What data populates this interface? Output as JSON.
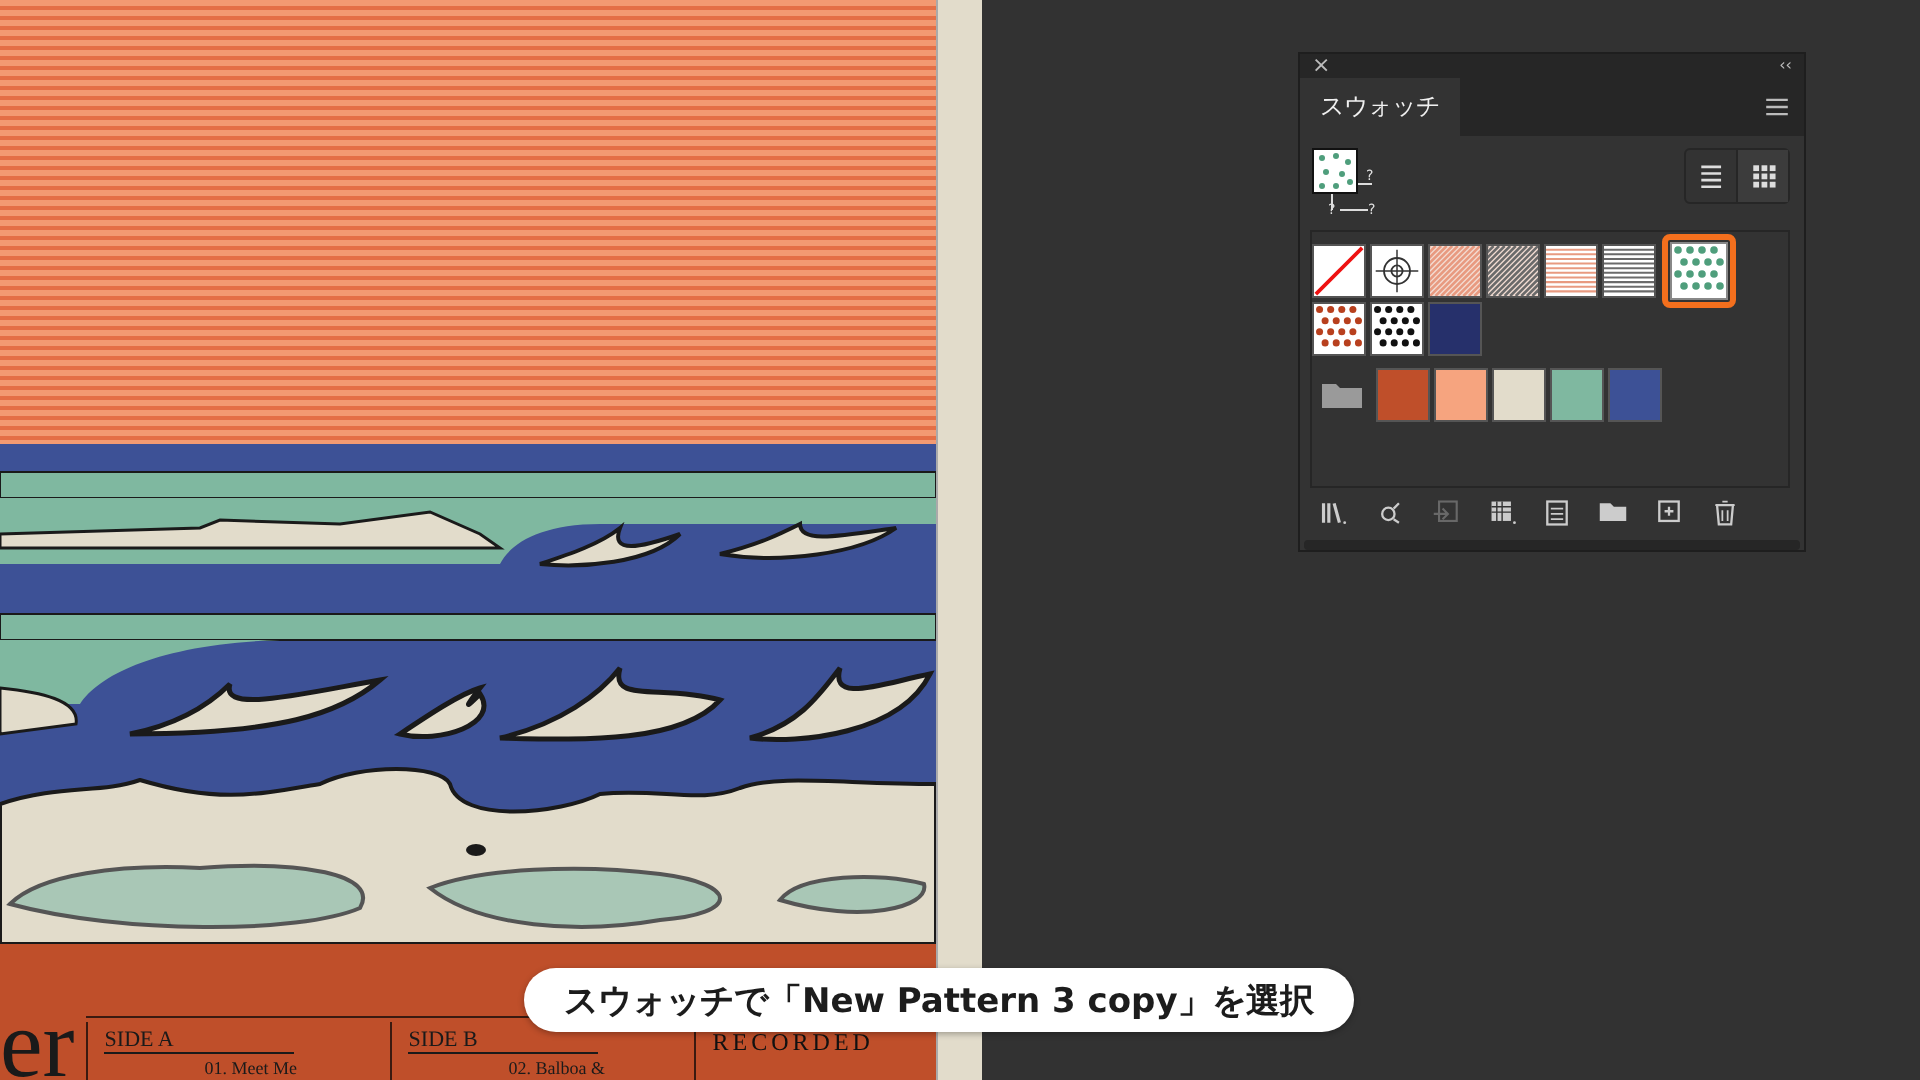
{
  "artwork": {
    "title_fragment": "er",
    "sections": [
      {
        "heading": "SIDE A",
        "track": "01. Meet Me"
      },
      {
        "heading": "SIDE B",
        "track": "02. Balboa &"
      },
      {
        "heading": "RECORDED"
      }
    ]
  },
  "panel": {
    "close": "×",
    "collapse": "‹‹",
    "fill_stroke_marks": [
      "?",
      "?",
      "?"
    ],
    "tabs": [
      {
        "label": "スウォッチ",
        "selected": true
      }
    ],
    "views": [
      {
        "kind": "list",
        "selected": false
      },
      {
        "kind": "thumbnail",
        "selected": true
      }
    ],
    "swatches": [
      {
        "kind": "none",
        "selected": false
      },
      {
        "kind": "registration",
        "selected": false
      },
      {
        "kind": "diagonal",
        "color": "#e89a80",
        "selected": false
      },
      {
        "kind": "diagonal",
        "color": "#6a6a6a",
        "selected": false
      },
      {
        "kind": "stripes",
        "color": "#e89a80",
        "selected": false
      },
      {
        "kind": "stripes",
        "color": "#6a6a6a",
        "selected": false
      },
      {
        "kind": "dots",
        "color": "#4f9e7c",
        "selected": true
      },
      {
        "kind": "dots",
        "color": "#b8401e",
        "selected": false
      },
      {
        "kind": "dots",
        "color": "#111111",
        "selected": false
      },
      {
        "kind": "solid",
        "color": "#26306b",
        "selected": false
      }
    ],
    "color_group": [
      {
        "color": "#bf4f2a"
      },
      {
        "color": "#f6a47f"
      },
      {
        "color": "#e2dccb"
      },
      {
        "color": "#7fb8a0"
      },
      {
        "color": "#3d5196"
      }
    ],
    "toolbar": [
      {
        "kind": "library",
        "disabled": false
      },
      {
        "kind": "options",
        "disabled": false
      },
      {
        "kind": "import",
        "disabled": true
      },
      {
        "kind": "kind-menu",
        "disabled": false
      },
      {
        "kind": "swatch-options",
        "disabled": false
      },
      {
        "kind": "folder",
        "disabled": false
      },
      {
        "kind": "new",
        "disabled": false
      },
      {
        "kind": "delete",
        "disabled": false
      }
    ]
  },
  "caption": "スウォッチで「New Pattern 3 copy」を選択"
}
